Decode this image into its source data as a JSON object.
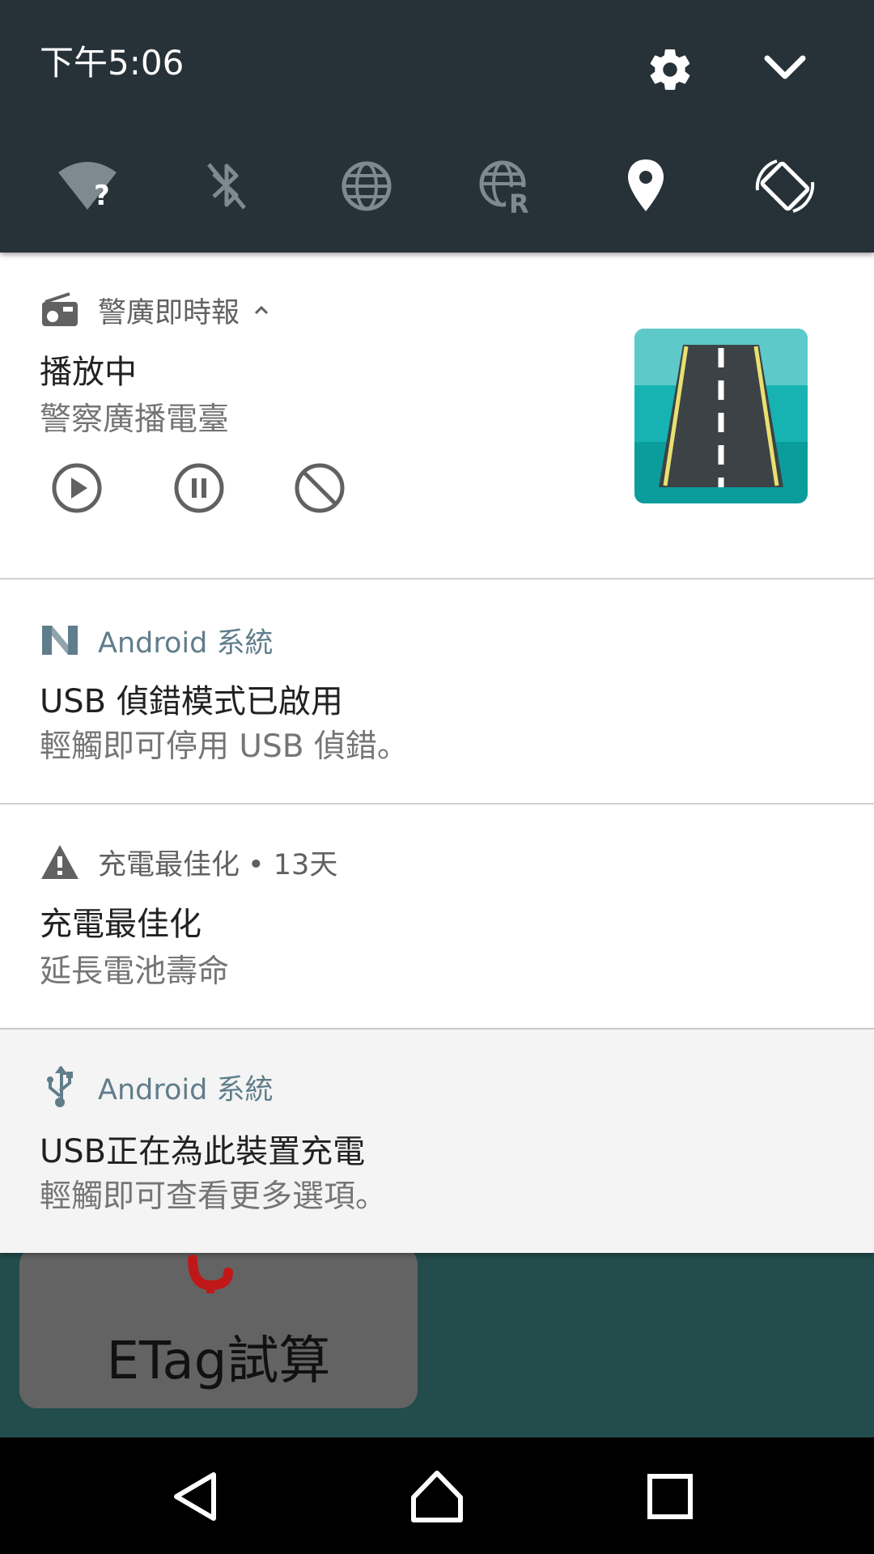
{
  "status": {
    "time": "下午5:06"
  },
  "quick_settings": {
    "icons": [
      "wifi-unknown-icon",
      "bluetooth-off-icon",
      "globe-icon",
      "roaming-icon",
      "location-icon",
      "auto-rotate-icon"
    ],
    "settings_icon": "gear-icon",
    "collapse_icon": "chevron-down-icon"
  },
  "notifications": [
    {
      "app": "警廣即時報",
      "title": "播放中",
      "text": "警察廣播電臺",
      "actions": [
        "play-icon",
        "pause-icon",
        "stop-icon"
      ]
    },
    {
      "app": "Android 系統",
      "title": "USB 偵錯模式已啟用",
      "text": "輕觸即可停用 USB 偵錯。"
    },
    {
      "app": "充電最佳化",
      "time": "• 13天",
      "title": "充電最佳化",
      "text": "延長電池壽命"
    },
    {
      "app": "Android 系統",
      "title": "USB正在為此裝置充電",
      "text": "輕觸即可查看更多選項。"
    }
  ],
  "background_app": {
    "button_label": "ETag試算"
  },
  "colors": {
    "header_bg": "#263238",
    "accent": "#607d8b",
    "app_bg": "#234c4c"
  }
}
